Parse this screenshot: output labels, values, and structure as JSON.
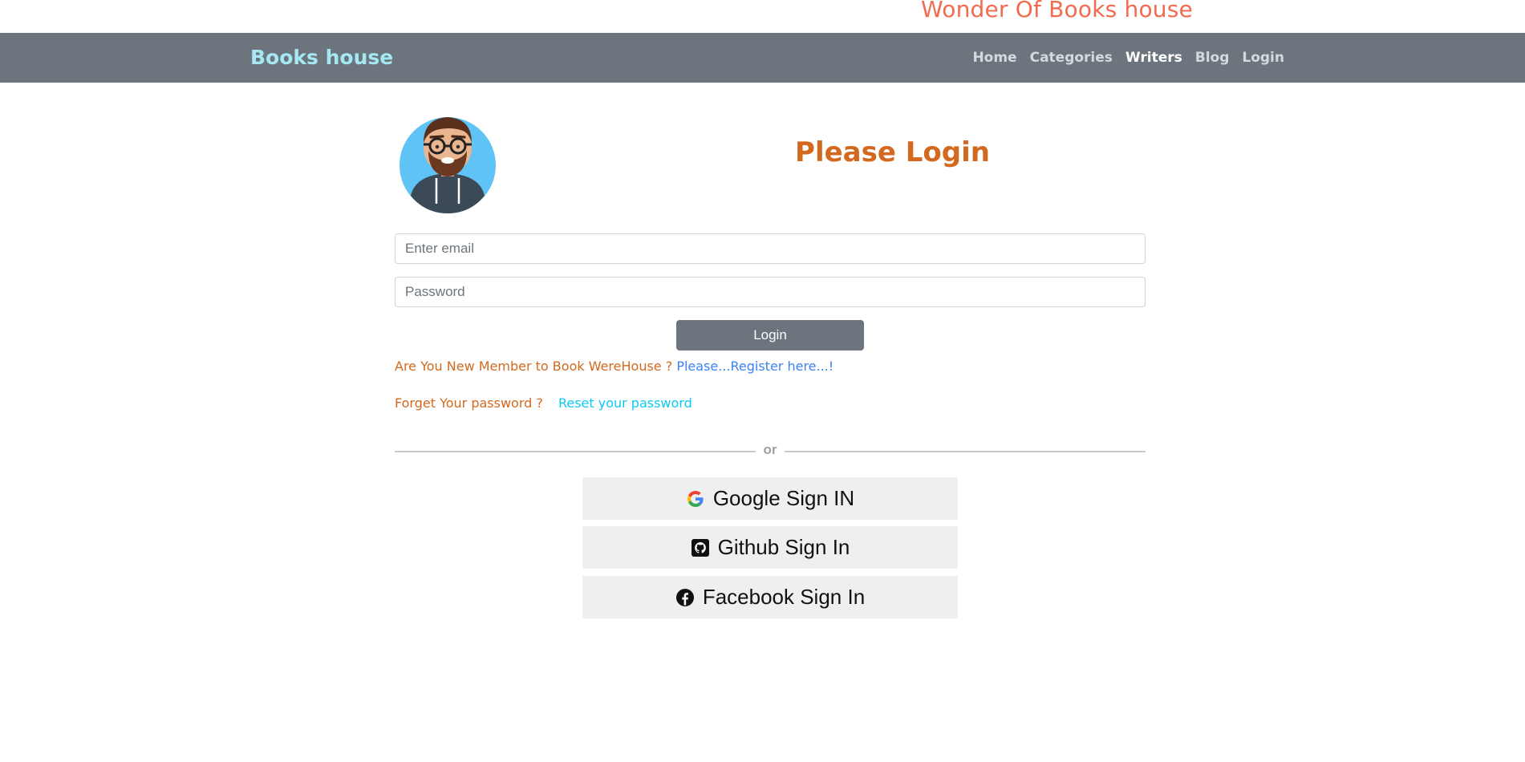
{
  "header": {
    "tagline": "Wonder Of Books house"
  },
  "navbar": {
    "brand": "Books house",
    "links": [
      {
        "label": "Home",
        "active": false
      },
      {
        "label": "Categories",
        "active": false
      },
      {
        "label": "Writers",
        "active": true
      },
      {
        "label": "Blog",
        "active": false
      },
      {
        "label": "Login",
        "active": false
      }
    ]
  },
  "login": {
    "title": "Please Login",
    "email_placeholder": "Enter email",
    "password_placeholder": "Password",
    "submit_label": "Login",
    "register_question": "Are You New Member to Book WereHouse ?",
    "register_link": "Please...Register here...!",
    "forgot_question": "Forget Your password ?",
    "reset_link": "Reset your password",
    "divider_text": "or"
  },
  "social": {
    "google_label": "Google Sign IN",
    "github_label": "Github Sign In",
    "facebook_label": "Facebook Sign In"
  },
  "colors": {
    "navbar_bg": "#6c757d",
    "brand": "#a5e8f3",
    "title": "#d2691e",
    "link": "#3b82f6",
    "reset_link": "#0dcaf0",
    "tagline": "#f26b4f"
  }
}
